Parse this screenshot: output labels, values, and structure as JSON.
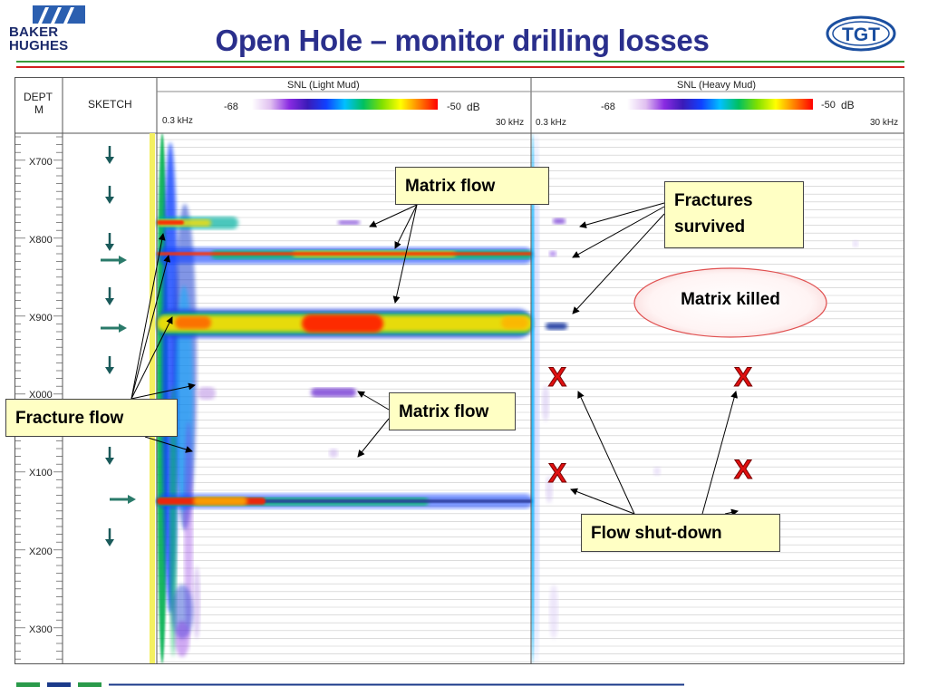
{
  "slide": {
    "title": "Open Hole – monitor drilling losses",
    "logo_left_lines": [
      "BAKER",
      "HUGHES"
    ],
    "logo_right_text": "TGT"
  },
  "log": {
    "depth_header": [
      "DEPT",
      "M"
    ],
    "sketch_header": "SKETCH",
    "depth_labels": [
      "X700",
      "X800",
      "X900",
      "X000",
      "X100",
      "X200",
      "X300"
    ],
    "tracks": [
      {
        "title": "SNL (Light Mud)",
        "scale_min": "-68",
        "scale_max": "-50",
        "scale_unit": "dB",
        "freq_min": "0.3 kHz",
        "freq_max": "30 kHz"
      },
      {
        "title": "SNL (Heavy Mud)",
        "scale_min": "-68",
        "scale_max": "-50",
        "scale_unit": "dB",
        "freq_min": "0.3 kHz",
        "freq_max": "30 kHz"
      }
    ],
    "colorscale": [
      "#ffffff",
      "#e0c0f0",
      "#8a2be2",
      "#3a1ab8",
      "#1040ff",
      "#00c0ff",
      "#00c060",
      "#80e000",
      "#ffff00",
      "#ff8000",
      "#ff0000"
    ]
  },
  "annotations": {
    "matrix_flow_top": "Matrix flow",
    "matrix_flow_mid": "Matrix flow",
    "fracture_flow": "Fracture flow",
    "fractures_survived": [
      "Fractures",
      "survived"
    ],
    "matrix_killed": "Matrix killed",
    "flow_shutdown": "Flow shut-down",
    "x_marks": [
      "X",
      "X",
      "X",
      "X"
    ]
  }
}
